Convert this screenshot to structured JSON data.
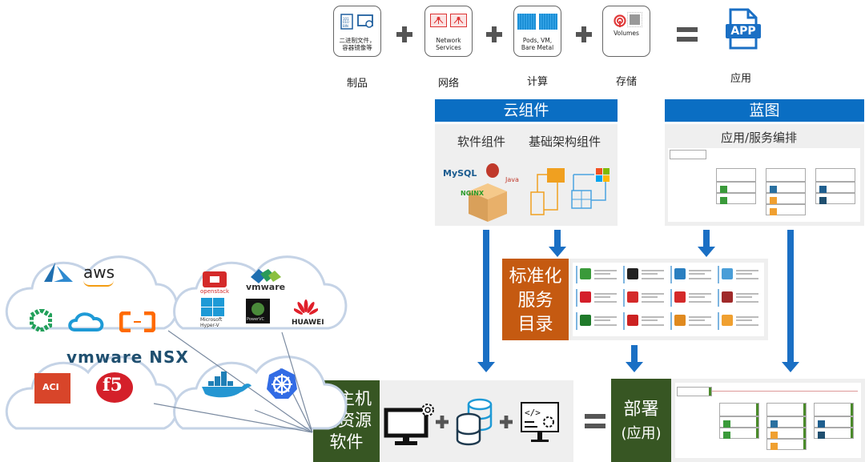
{
  "top_formula": {
    "items": [
      {
        "caption": "二进制文件，\n容器镜像等",
        "label": "制品",
        "icon": "binary-file-and-settings-icon"
      },
      {
        "caption": "Network\nServices",
        "label": "网络",
        "icon": "network-services-icon"
      },
      {
        "caption": "Pods, VM,\nBare Metal",
        "label": "计算",
        "icon": "compute-blocks-icon"
      },
      {
        "caption": "Volumes",
        "label": "存储",
        "icon": "storage-volume-icon"
      }
    ],
    "result": {
      "icon_text": "APP",
      "label": "应用"
    }
  },
  "cloud_components": {
    "title": "云组件",
    "software_label": "软件组件",
    "infra_label": "基础架构组件",
    "software_logos": [
      "MySQL",
      "Jenkins",
      "Java",
      "NGINX"
    ],
    "colors": {
      "header": "#0a6ec3",
      "panel": "#efefef"
    }
  },
  "blueprint": {
    "title": "蓝图",
    "subtitle": "应用/服务编排"
  },
  "catalog": {
    "title_lines": [
      "标准化",
      "服务",
      "目录"
    ],
    "color": "#c55a11",
    "cards": [
      {
        "icon_color": "#3a9a3a"
      },
      {
        "icon_color": "#222222"
      },
      {
        "icon_color": "#2a7fc0"
      },
      {
        "icon_color": "#4a9ed8"
      },
      {
        "icon_color": "#d41e2a"
      },
      {
        "icon_color": "#d42a2a"
      },
      {
        "icon_color": "#d42a2a"
      },
      {
        "icon_color": "#a02a2a"
      },
      {
        "icon_color": "#1f7a2a"
      },
      {
        "icon_color": "#cc2222"
      },
      {
        "icon_color": "#e08a20"
      },
      {
        "icon_color": "#f0a030"
      }
    ]
  },
  "cloud_host": {
    "title_lines": [
      "云主机",
      "云资源",
      "软件"
    ],
    "icons": [
      "monitor-gear-icon",
      "database-icon",
      "code-config-icon"
    ],
    "color": "#375623"
  },
  "deploy": {
    "title_lines": [
      "部署",
      "(应用)"
    ],
    "color": "#375623"
  },
  "clouds": [
    {
      "name": "public-cloud",
      "logos": [
        "Azure",
        "aws",
        "QingCloud",
        "Tencent Cloud",
        "Alibaba Cloud"
      ]
    },
    {
      "name": "private-cloud",
      "logos": [
        "openstack",
        "vmware",
        "Microsoft Hyper-V",
        "PowerVC",
        "HUAWEI"
      ]
    },
    {
      "name": "network-cloud",
      "logos": [
        "vmware NSX",
        "ACI",
        "f5"
      ]
    },
    {
      "name": "container-cloud",
      "logos": [
        "docker",
        "kubernetes"
      ]
    }
  ]
}
